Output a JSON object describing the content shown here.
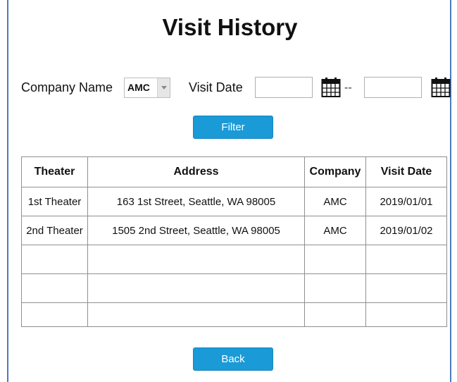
{
  "page": {
    "title": "Visit History"
  },
  "filters": {
    "company_label": "Company Name",
    "company_selected": "AMC",
    "date_label": "Visit Date",
    "date_separator": "--",
    "date_from_value": "",
    "date_to_value": "",
    "filter_button": "Filter"
  },
  "table": {
    "headers": [
      "Theater",
      "Address",
      "Company",
      "Visit Date"
    ],
    "rows": [
      [
        "1st Theater",
        "163 1st Street, Seattle, WA 98005",
        "AMC",
        "2019/01/01"
      ],
      [
        "2nd Theater",
        "1505 2nd Street, Seattle, WA 98005",
        "AMC",
        "2019/01/02"
      ]
    ]
  },
  "footer": {
    "back_button": "Back"
  },
  "colors": {
    "accent": "#1a9ad7",
    "frame_border": "#4a7bbf",
    "grid_border": "#8f8f8f"
  },
  "icons": {
    "calendar": "calendar-icon",
    "dropdown": "chevron-down-icon"
  }
}
